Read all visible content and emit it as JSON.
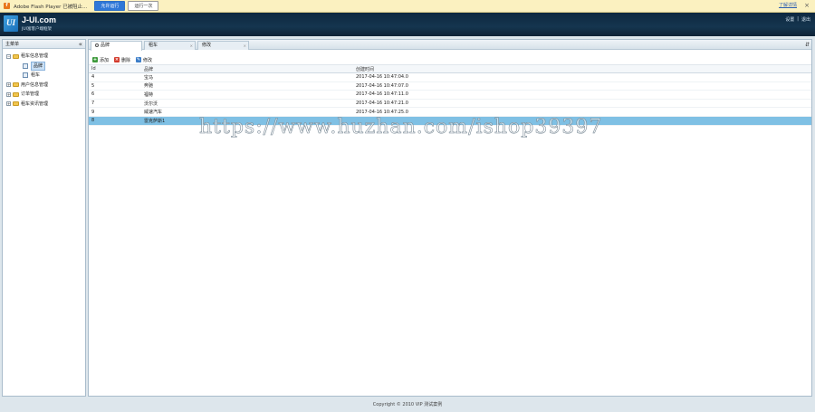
{
  "flashbar": {
    "icon": "flash-plugin-icon",
    "text": "Adobe Flash Player 已被阻止...",
    "run_button": "允许运行",
    "run_once_button": "运行一次",
    "manage_link": "了解详情",
    "close_symbol": "×"
  },
  "header": {
    "logo_glyph": "UI",
    "title": "J-UI.com",
    "subtitle": "JUI富客户端框架",
    "links": [
      "设置",
      "|",
      "退出"
    ]
  },
  "sidebar": {
    "title": "主菜单",
    "collapse_symbol": "«",
    "items": [
      {
        "label": "租车信息管理",
        "toggle": "−",
        "level": 1
      },
      {
        "label": "品牌",
        "level": 2,
        "selected": true
      },
      {
        "label": "租车",
        "level": 2
      },
      {
        "label": "用户信息管理",
        "toggle": "+",
        "level": 1
      },
      {
        "label": "订单管理",
        "toggle": "+",
        "level": 1
      },
      {
        "label": "租车资讯管理",
        "toggle": "+",
        "level": 1
      }
    ]
  },
  "tabs": {
    "items": [
      {
        "label": "品牌",
        "active": true
      },
      {
        "label": "租车",
        "close": "×"
      },
      {
        "label": "修改",
        "close": "×"
      }
    ],
    "more_symbol": "⇵"
  },
  "toolbar": {
    "add_label": "添加",
    "delete_label": "删除",
    "edit_label": "修改"
  },
  "grid": {
    "columns": [
      "Id",
      "品牌",
      "创建时间"
    ],
    "rows": [
      {
        "id": "4",
        "brand": "宝马",
        "time": "2017-04-16 10:47:04.0"
      },
      {
        "id": "5",
        "brand": "奔驰",
        "time": "2017-04-16 10:47:07.0"
      },
      {
        "id": "6",
        "brand": "福特",
        "time": "2017-04-16 10:47:11.0"
      },
      {
        "id": "7",
        "brand": "沃尔沃",
        "time": "2017-04-16 10:47:21.0"
      },
      {
        "id": "9",
        "brand": "威速汽车",
        "time": "2017-04-16 10:47:25.0"
      },
      {
        "id": "8",
        "brand": "雷克萨斯1",
        "time": "",
        "selected": true
      }
    ]
  },
  "watermark": "https://www.huzhan.com/ishop39397",
  "footer": "Copyright © 2010 VIP 测试案例",
  "colors": {
    "header_bg": "#15354f",
    "selected_row": "#7fc0e4",
    "flashbar_bg": "#fbf1c0",
    "primary_button": "#2f78d8"
  }
}
